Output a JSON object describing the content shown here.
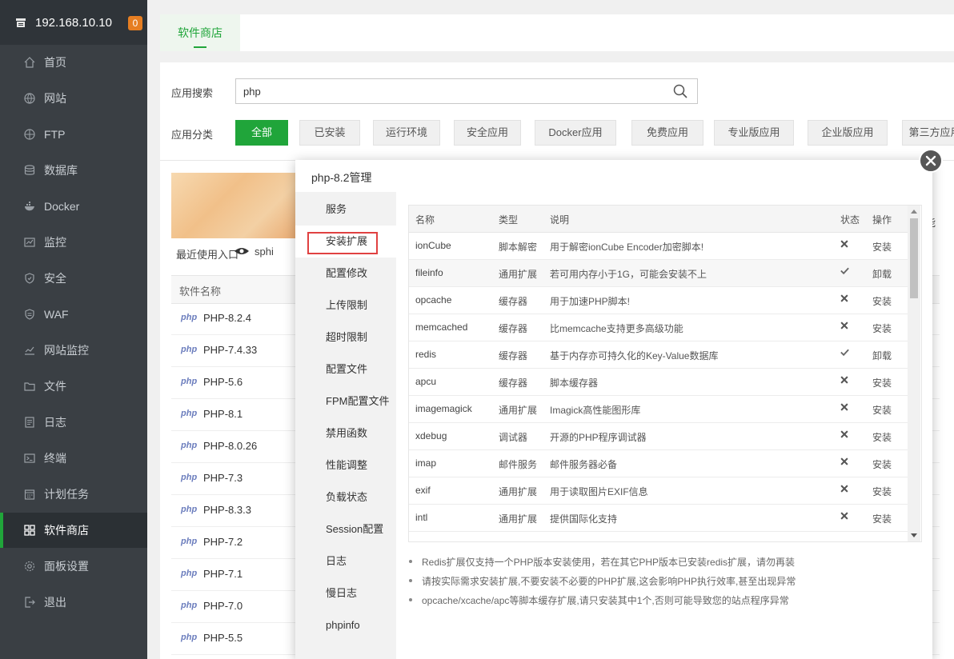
{
  "sidebar": {
    "ip": "192.168.10.10",
    "badge": "0",
    "items": [
      {
        "label": "首页",
        "icon": "home-icon"
      },
      {
        "label": "网站",
        "icon": "globe-icon"
      },
      {
        "label": "FTP",
        "icon": "ftp-globe-icon"
      },
      {
        "label": "数据库",
        "icon": "database-icon"
      },
      {
        "label": "Docker",
        "icon": "docker-icon"
      },
      {
        "label": "监控",
        "icon": "monitor-chart-icon"
      },
      {
        "label": "安全",
        "icon": "shield-icon"
      },
      {
        "label": "WAF",
        "icon": "waf-shield-icon"
      },
      {
        "label": "网站监控",
        "icon": "site-monitor-icon"
      },
      {
        "label": "文件",
        "icon": "folder-icon"
      },
      {
        "label": "日志",
        "icon": "log-icon"
      },
      {
        "label": "终端",
        "icon": "terminal-icon"
      },
      {
        "label": "计划任务",
        "icon": "calendar-icon"
      },
      {
        "label": "软件商店",
        "icon": "grid-icon"
      },
      {
        "label": "面板设置",
        "icon": "settings-icon"
      },
      {
        "label": "退出",
        "icon": "logout-icon"
      }
    ],
    "active_index": 13
  },
  "topbar": {
    "tab": "软件商店"
  },
  "search": {
    "label": "应用搜索",
    "value": "php"
  },
  "categories": {
    "label": "应用分类",
    "items": [
      "全部",
      "已安装",
      "运行环境",
      "安全应用",
      "Docker应用",
      "免费应用",
      "专业版应用",
      "企业版应用",
      "第三方应用"
    ],
    "active_index": 0
  },
  "recent": {
    "label": "最近使用入口",
    "item": "sphi"
  },
  "right_clip": "能",
  "soft_table": {
    "header": "软件名称",
    "rows": [
      "PHP-8.2.4",
      "PHP-7.4.33",
      "PHP-5.6",
      "PHP-8.1",
      "PHP-8.0.26",
      "PHP-7.3",
      "PHP-8.3.3",
      "PHP-7.2",
      "PHP-7.1",
      "PHP-7.0",
      "PHP-5.5"
    ],
    "logo_text": "php"
  },
  "modal": {
    "title": "php-8.2管理",
    "nav": [
      "服务",
      "安装扩展",
      "配置修改",
      "上传限制",
      "超时限制",
      "配置文件",
      "FPM配置文件",
      "禁用函数",
      "性能调整",
      "负载状态",
      "Session配置",
      "日志",
      "慢日志",
      "phpinfo"
    ],
    "active_nav": 1,
    "ext_columns": {
      "name": "名称",
      "type": "类型",
      "desc": "说明",
      "status": "状态",
      "op": "操作"
    },
    "extensions": [
      {
        "name": "ionCube",
        "type": "脚本解密",
        "desc": "用于解密ionCube Encoder加密脚本!",
        "installed": false,
        "op": "安装"
      },
      {
        "name": "fileinfo",
        "type": "通用扩展",
        "desc": "若可用内存小于1G，可能会安装不上",
        "installed": true,
        "op": "卸载"
      },
      {
        "name": "opcache",
        "type": "缓存器",
        "desc": "用于加速PHP脚本!",
        "installed": false,
        "op": "安装"
      },
      {
        "name": "memcached",
        "type": "缓存器",
        "desc": "比memcache支持更多高级功能",
        "installed": false,
        "op": "安装"
      },
      {
        "name": "redis",
        "type": "缓存器",
        "desc": "基于内存亦可持久化的Key-Value数据库",
        "installed": true,
        "op": "卸载"
      },
      {
        "name": "apcu",
        "type": "缓存器",
        "desc": "脚本缓存器",
        "installed": false,
        "op": "安装"
      },
      {
        "name": "imagemagick",
        "type": "通用扩展",
        "desc": "Imagick高性能图形库",
        "installed": false,
        "op": "安装"
      },
      {
        "name": "xdebug",
        "type": "调试器",
        "desc": "开源的PHP程序调试器",
        "installed": false,
        "op": "安装"
      },
      {
        "name": "imap",
        "type": "邮件服务",
        "desc": "邮件服务器必备",
        "installed": false,
        "op": "安装"
      },
      {
        "name": "exif",
        "type": "通用扩展",
        "desc": "用于读取图片EXIF信息",
        "installed": false,
        "op": "安装"
      },
      {
        "name": "intl",
        "type": "通用扩展",
        "desc": "提供国际化支持",
        "installed": false,
        "op": "安装"
      }
    ],
    "notes": [
      "Redis扩展仅支持一个PHP版本安装使用，若在其它PHP版本已安装redis扩展，请勿再装",
      "请按实际需求安装扩展,不要安装不必要的PHP扩展,这会影响PHP执行效率,甚至出现异常",
      "opcache/xcache/apc等脚本缓存扩展,请只安装其中1个,否则可能导致您的站点程序异常"
    ]
  },
  "colors": {
    "accent": "#20a53a",
    "sidebar": "#3a3f44",
    "danger": "#e02a2a",
    "badge": "#e67e22"
  }
}
